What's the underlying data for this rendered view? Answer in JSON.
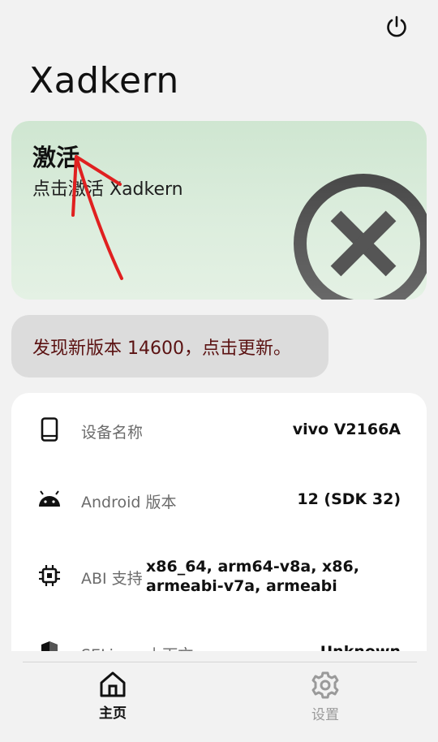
{
  "app": {
    "title": "Xadkern"
  },
  "toolbar": {
    "power_icon": "power-icon"
  },
  "activate_card": {
    "title": "激活",
    "subtitle": "点击激活 Xadkern",
    "status_icon": "close-circle-icon",
    "annotation": "red-arrow-annotation"
  },
  "update_banner": {
    "text": "发现新版本 14600，点击更新。"
  },
  "info": {
    "rows": [
      {
        "icon": "phone-icon",
        "label": "设备名称",
        "value": "vivo V2166A"
      },
      {
        "icon": "android-icon",
        "label": "Android 版本",
        "value": "12 (SDK 32)"
      },
      {
        "icon": "chip-icon",
        "label": "ABI 支持",
        "value": "x86_64, arm64-v8a, x86, armeabi-v7a, armeabi"
      },
      {
        "icon": "shield-icon",
        "label": "SELinux 上下文",
        "value": "Unknown"
      }
    ]
  },
  "nav": {
    "home": {
      "label": "主页",
      "icon": "home-icon"
    },
    "settings": {
      "label": "设置",
      "icon": "gear-icon"
    }
  },
  "colors": {
    "card_green": "#d6ead7",
    "update_text": "#5b1212",
    "annotation_red": "#e02020"
  }
}
